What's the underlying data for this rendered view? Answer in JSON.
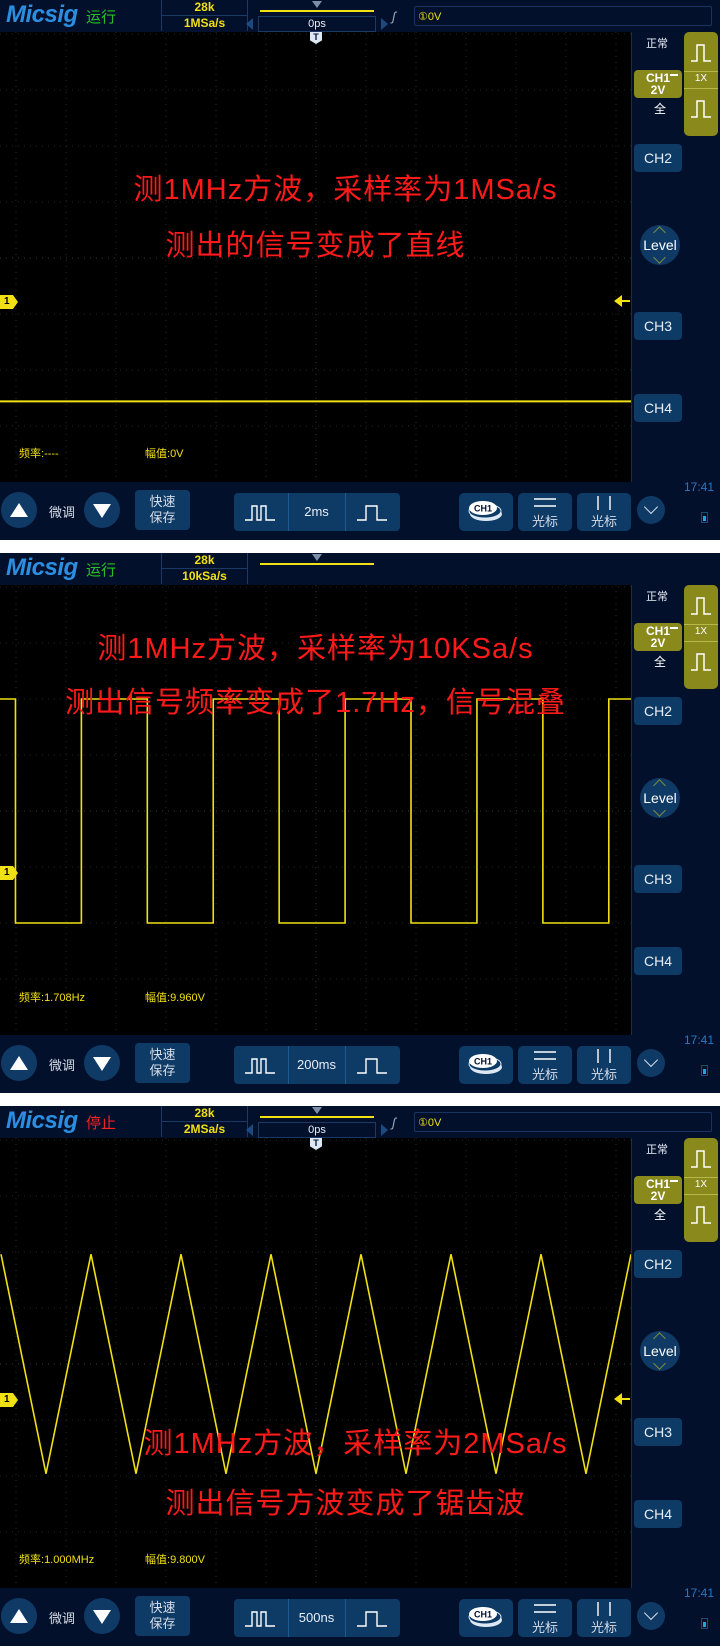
{
  "app": {
    "brand": "Micsig",
    "colors": {
      "trace": "#f0e014",
      "run": "#27c127",
      "stop": "#ff2020",
      "overlay_text": "#ff1a1a",
      "panel_bg": "#03102c",
      "button_bg": "#0e3a66",
      "ch1_olive": "#8a8a1c"
    }
  },
  "common": {
    "memory_depth": "28k",
    "trigger_mode": "正常",
    "ch1_label": "CH1",
    "ch1_scale": "2V",
    "ch1_coupling": "全",
    "probe_ratio": "1X",
    "ch2_label": "CH2",
    "ch3_label": "CH3",
    "ch4_label": "CH4",
    "level_label": "Level",
    "ch1_marker": "1",
    "trigger_marker": "T",
    "fine_label": "微调",
    "quicksave_label_line1": "快速",
    "quicksave_label_line2": "保存",
    "ch1_badge": "CH1",
    "hcursor_label": "光标",
    "vcursor_label": "光标",
    "clock": "17:41",
    "freq_prefix": "频率:",
    "amp_prefix": "幅值:"
  },
  "panels": [
    {
      "run_state": "运行",
      "run_state_color": "#27c127",
      "sample_rate": "1MSa/s",
      "h_delay": "0ps",
      "trigger_level": "①0V",
      "timebase": "2ms",
      "frequency": "----",
      "amplitude": "0V",
      "overlay_line1": "测1MHz方波，采样率为1MSa/s",
      "overlay_line2": "测出的信号变成了直线",
      "waveform": {
        "type": "flat",
        "level_div": -3.2
      }
    },
    {
      "run_state": "运行",
      "run_state_color": "#27c127",
      "sample_rate": "10kSa/s",
      "h_delay": "",
      "trigger_level": "",
      "timebase": "200ms",
      "frequency": "1.708Hz",
      "amplitude": "9.960V",
      "overlay_line1": "测1MHz方波，采样率为10KSa/s",
      "overlay_line2": "测出信号频率变成了1.7Hz，信号混叠",
      "waveform": {
        "type": "square",
        "high_div": 2.5,
        "low_div": -2.5,
        "period_div": 2.93,
        "first_rise_div": 1.75
      }
    },
    {
      "run_state": "停止",
      "run_state_color": "#ff2020",
      "sample_rate": "2MSa/s",
      "h_delay": "0ps",
      "trigger_level": "①0V",
      "timebase": "500ns",
      "frequency": "1.000MHz",
      "amplitude": "9.800V",
      "overlay_line1": "测1MHz方波，采样率为2MSa/s",
      "overlay_line2": "测出信号方波变成了锯齿波",
      "waveform": {
        "type": "triangle",
        "high_div": 2.45,
        "low_div": -2.45,
        "period_div": 2.0,
        "first_peak_div": 0.0
      }
    }
  ]
}
